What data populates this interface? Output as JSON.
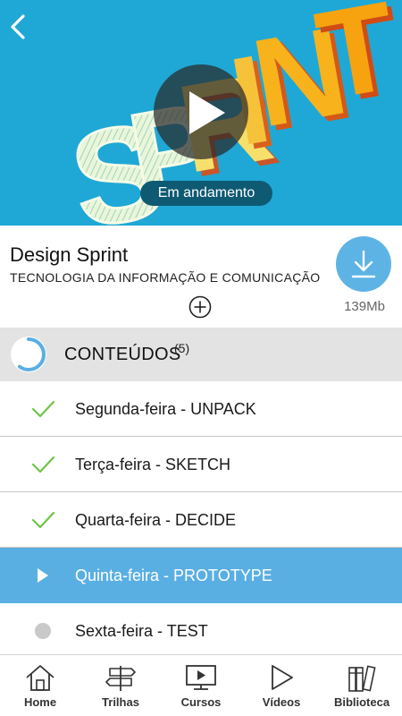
{
  "hero": {
    "art_text": "SPRINT",
    "status": "Em andamento",
    "back_icon": "chevron-left-icon",
    "play_icon": "play-icon",
    "background_color": "#1fa8d6"
  },
  "course": {
    "title": "Design Sprint",
    "category": "TECNOLOGIA DA INFORMAÇÃO E COMUNICAÇÃO",
    "add_icon": "plus-circle-icon",
    "download_icon": "download-icon",
    "download_size": "139Mb",
    "accent_color": "#5db3e4"
  },
  "contents": {
    "title": "CONTEÚDOS",
    "count": "(5)",
    "progress": 0.6,
    "items": [
      {
        "label": "Segunda-feira - UNPACK",
        "state": "done",
        "icon": "check-icon"
      },
      {
        "label": "Terça-feira - SKETCH",
        "state": "done",
        "icon": "check-icon"
      },
      {
        "label": "Quarta-feira - DECIDE",
        "state": "done",
        "icon": "check-icon"
      },
      {
        "label": "Quinta-feira - PROTOTYPE",
        "state": "active",
        "icon": "play-icon"
      },
      {
        "label": "Sexta-feira - TEST",
        "state": "pending",
        "icon": "dot-icon"
      }
    ]
  },
  "bottom_nav": {
    "items": [
      {
        "label": "Home",
        "icon": "home-icon"
      },
      {
        "label": "Trilhas",
        "icon": "signpost-icon"
      },
      {
        "label": "Cursos",
        "icon": "monitor-icon"
      },
      {
        "label": "Vídeos",
        "icon": "play-outline-icon"
      },
      {
        "label": "Biblioteca",
        "icon": "books-icon"
      }
    ]
  }
}
